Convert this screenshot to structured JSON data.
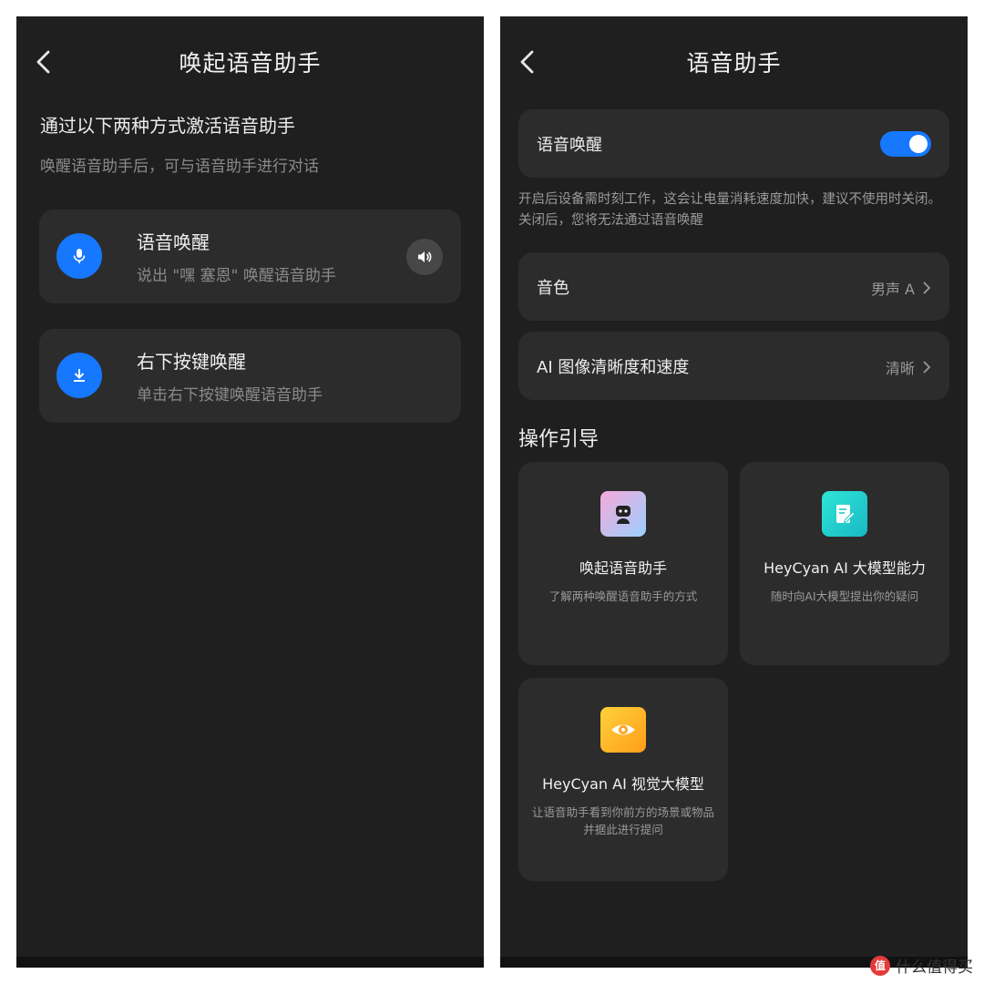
{
  "left_screen": {
    "title": "唤起语音助手",
    "intro_title": "通过以下两种方式激活语音助手",
    "intro_sub": "唤醒语音助手后，可与语音助手进行对话",
    "cards": [
      {
        "title": "语音唤醒",
        "sub": "说出 \"嘿 塞恩\" 唤醒语音助手",
        "icon": "mic-icon"
      },
      {
        "title": "右下按键唤醒",
        "sub": "单击右下按键唤醒语音助手",
        "icon": "download-icon"
      }
    ]
  },
  "right_screen": {
    "title": "语音助手",
    "voice_wake": {
      "label": "语音唤醒",
      "enabled": true
    },
    "hint": "开启后设备需时刻工作，这会让电量消耗速度加快，建议不使用时关闭。关闭后，您将无法通过语音唤醒",
    "timbre": {
      "label": "音色",
      "value": "男声 A"
    },
    "ai_image": {
      "label": "AI 图像清晰度和速度",
      "value": "清晰"
    },
    "section_title": "操作引导",
    "guides": [
      {
        "title": "唤起语音助手",
        "sub": "了解两种唤醒语音助手的方式",
        "icon": "robot-icon"
      },
      {
        "title": "HeyCyan AI 大模型能力",
        "sub": "随时向AI大模型提出你的疑问",
        "icon": "edit-note-icon"
      },
      {
        "title": "HeyCyan AI 视觉大模型",
        "sub": "让语音助手看到你前方的场景或物品并据此进行提问",
        "icon": "eye-icon"
      }
    ]
  },
  "watermark": {
    "logo_text": "值",
    "text": "什么值得买"
  },
  "colors": {
    "background": "#1f1f1f",
    "card": "#2c2c2c",
    "accent": "#1677ff"
  }
}
